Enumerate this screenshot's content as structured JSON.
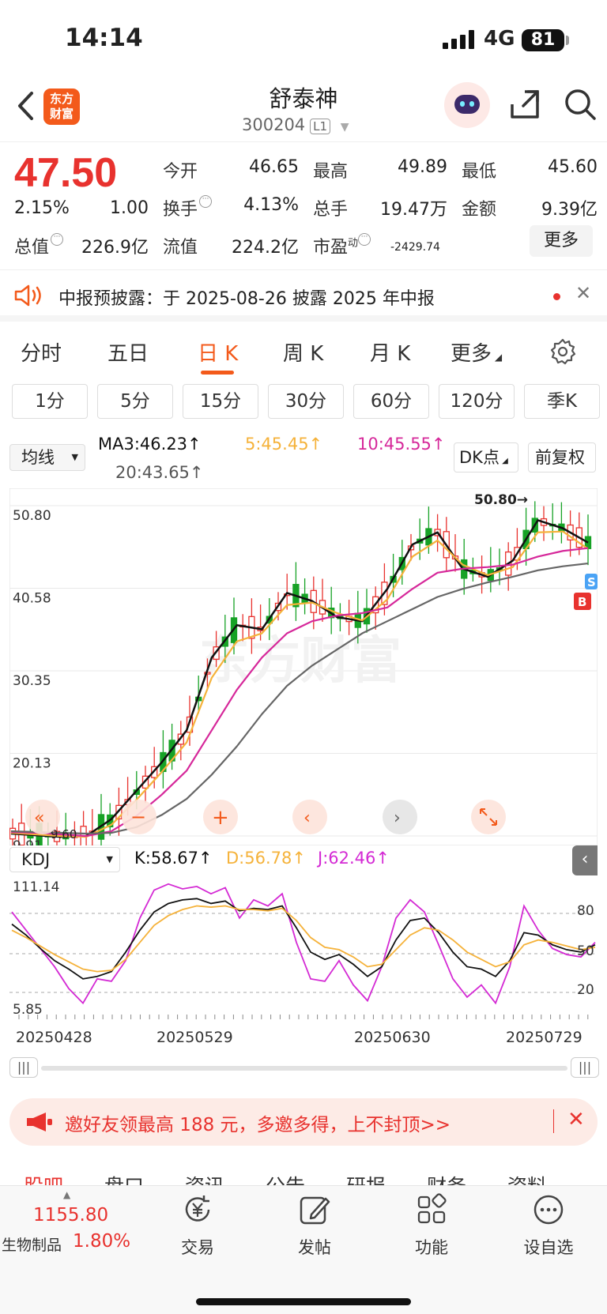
{
  "status_bar": {
    "time": "14:14",
    "network": "4G",
    "battery": "81"
  },
  "header": {
    "logo_line1": "东方",
    "logo_line2": "财富",
    "stock_name": "舒泰神",
    "stock_code": "300204",
    "level_badge": "L1"
  },
  "quote": {
    "price": "47.50",
    "change_pct": "2.15%",
    "change": "1.00",
    "open_label": "今开",
    "open": "46.65",
    "high_label": "最高",
    "high": "49.89",
    "low_label": "最低",
    "low": "45.60",
    "turnover_label": "换手",
    "turnover": "4.13%",
    "volume_label": "总手",
    "volume": "19.47万",
    "amount_label": "金额",
    "amount": "9.39亿",
    "mktcap_label": "总值",
    "mktcap": "226.9亿",
    "float_label": "流值",
    "float_cap": "224.2亿",
    "pe_label": "市盈",
    "pe_sup": "动",
    "pe": "-2429.74",
    "more": "更多"
  },
  "notice": {
    "text": "中报预披露：于 2025-08-26 披露 2025 年中报"
  },
  "period_tabs": [
    "分时",
    "五日",
    "日 K",
    "周 K",
    "月 K",
    "更多"
  ],
  "active_period": "日 K",
  "minute_buttons": [
    "1分",
    "5分",
    "15分",
    "30分",
    "60分",
    "120分",
    "季K"
  ],
  "ma_row": {
    "dropdown": "均线",
    "ma3": "MA3:46.23↑",
    "ma5": "5:45.45↑",
    "ma10": "10:45.55↑",
    "ma20": "20:43.65↑",
    "dk_button": "DK点",
    "adjust_button": "前复权"
  },
  "kline_labels": {
    "y_ticks": [
      "50.80",
      "40.58",
      "30.35",
      "20.13",
      "9.91"
    ],
    "max_marker": "50.80→",
    "low_marker": "9.60",
    "s_marker": "S",
    "b_marker": "B",
    "watermark": "东方财富"
  },
  "kdj_row": {
    "dropdown": "KDJ",
    "k": "K:58.67↑",
    "d": "D:56.78↑",
    "j": "J:62.46↑",
    "y_max": "111.14",
    "y_min": "5.85",
    "levels": [
      "80",
      "50",
      "20"
    ]
  },
  "dates": [
    "20250428",
    "20250529",
    "20250630",
    "20250729"
  ],
  "colors": {
    "up": "#e8322e",
    "down": "#17a226",
    "brand": "#f35a1b",
    "ma3": "#111111",
    "ma5": "#f5b23a",
    "ma10": "#d6289a",
    "ma20": "#666666",
    "j_line": "#d42ad4"
  },
  "chart_data": {
    "type": "line",
    "title": "",
    "x": [
      "20250428",
      "20250529",
      "20250630",
      "20250729"
    ],
    "ylim": [
      9.91,
      50.8
    ],
    "series": [
      {
        "name": "MA3",
        "values": [
          10.2,
          10.0,
          9.8,
          9.9,
          12.0,
          15.5,
          19.0,
          23.0,
          32.0,
          36.0,
          35.5,
          40.0,
          39.0,
          37.0,
          36.5,
          40.5,
          46.0,
          47.5,
          43.0,
          42.0,
          44.0,
          49.0,
          48.0,
          46.23
        ]
      },
      {
        "name": "MA5",
        "values": [
          10.3,
          10.1,
          9.9,
          9.8,
          11.3,
          14.4,
          17.8,
          21.5,
          29.5,
          34.0,
          35.0,
          38.5,
          38.8,
          37.5,
          36.6,
          39.2,
          44.5,
          46.5,
          43.5,
          42.2,
          43.2,
          47.5,
          47.6,
          45.45
        ]
      },
      {
        "name": "MA10",
        "values": [
          10.4,
          10.3,
          10.1,
          9.9,
          10.5,
          12.4,
          15.0,
          18.0,
          23.0,
          28.0,
          32.0,
          35.0,
          36.5,
          37.2,
          37.5,
          38.2,
          40.5,
          42.5,
          43.0,
          43.2,
          43.5,
          44.5,
          45.2,
          45.55
        ]
      },
      {
        "name": "MA20",
        "values": [
          10.5,
          10.4,
          10.3,
          10.2,
          10.3,
          11.0,
          12.5,
          14.5,
          17.5,
          21.0,
          25.0,
          28.5,
          31.0,
          33.0,
          35.0,
          36.5,
          38.0,
          39.5,
          40.5,
          41.3,
          42.0,
          42.8,
          43.3,
          43.65
        ]
      }
    ]
  }
}
